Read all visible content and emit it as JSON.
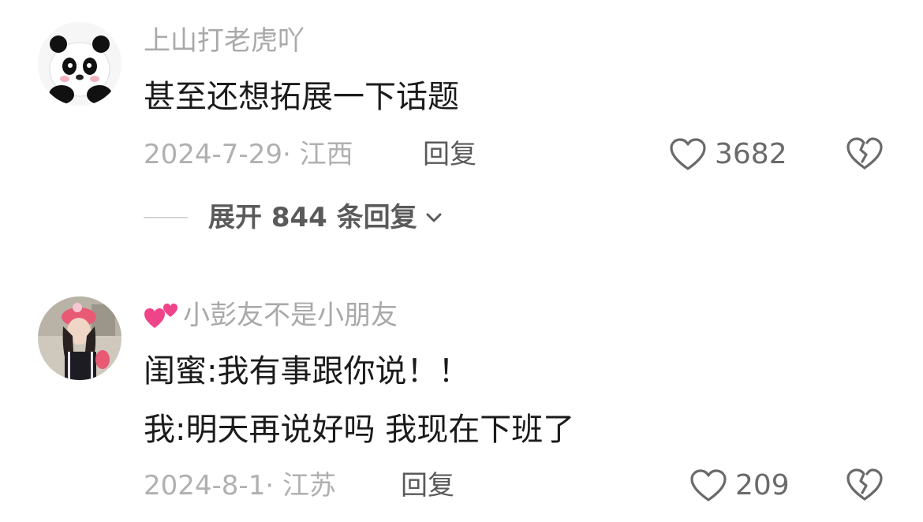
{
  "comments": [
    {
      "username": "上山打老虎吖",
      "lines": [
        "甚至还想拓展一下话题"
      ],
      "date": "2024-7-29",
      "location_sep": "·",
      "location": "江西",
      "reply_label": "回复",
      "like_count": "3682",
      "expand_label": "展开 844 条回复",
      "avatar_icon": "panda-avatar-icon"
    },
    {
      "username": "小彭友不是小朋友",
      "lines": [
        "闺蜜:我有事跟你说！！",
        "我:明天再说好吗 我现在下班了"
      ],
      "date": "2024-8-1",
      "location_sep": "·",
      "location": "江苏",
      "reply_label": "回复",
      "like_count": "209",
      "avatar_icon": "girl-photo-avatar-icon",
      "name_emoji": "two-hearts-icon"
    }
  ],
  "colors": {
    "username": "#a9a9a9",
    "meta": "#b0b0b0",
    "text": "#1b1b1b",
    "icon": "#6a6a6a"
  }
}
